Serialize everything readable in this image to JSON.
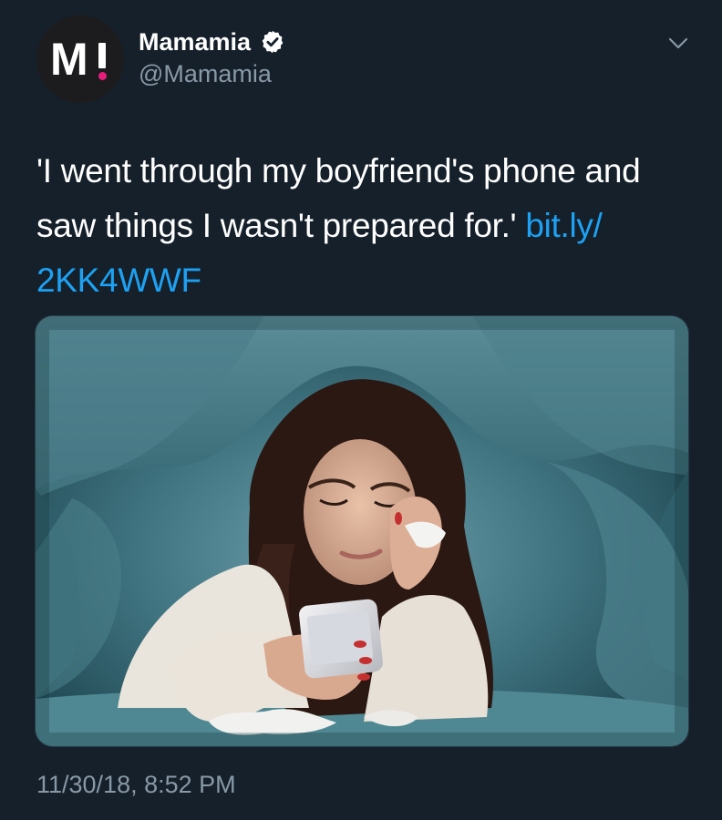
{
  "author": {
    "display_name": "Mamamia",
    "handle": "@Mamamia",
    "avatar_letter": "M",
    "verified_icon": "verified-badge-icon",
    "accent_color": "#e91e7c"
  },
  "menu": {
    "icon": "chevron-down-icon"
  },
  "tweet": {
    "text_line1": "'I went through my boyfriend's phone and",
    "text_line2_prefix": "saw things I wasn't prepared for.' ",
    "link_part1": "bit.ly/",
    "link_part2": "2KK4WWF",
    "link_color": "#1da1f2"
  },
  "media": {
    "icon": "photo-image",
    "subject": "woman-under-blanket-looking-at-phone"
  },
  "meta": {
    "timestamp": "11/30/18, 8:52 PM"
  },
  "colors": {
    "background": "#15202b",
    "secondary_text": "#8899a6"
  }
}
